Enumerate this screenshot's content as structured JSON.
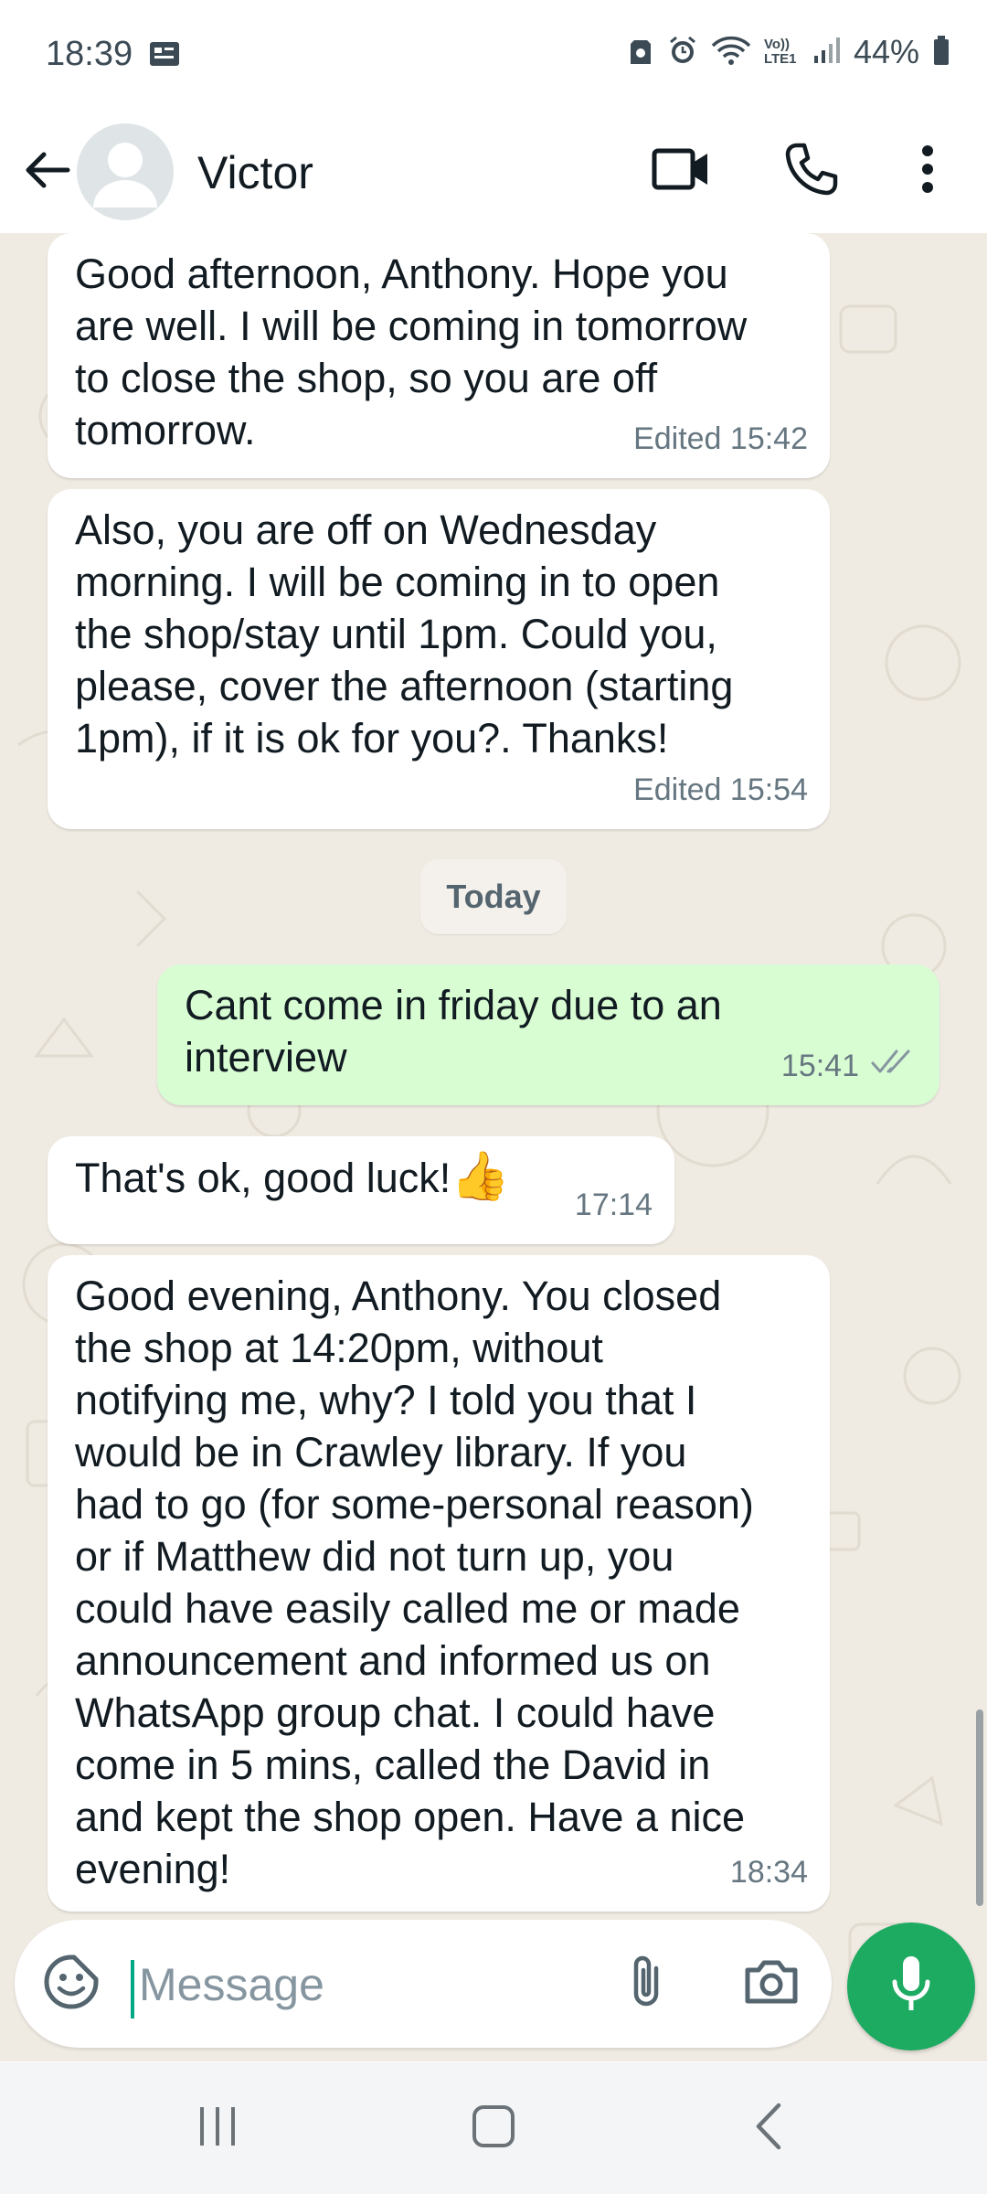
{
  "status_bar": {
    "time": "18:39",
    "network_label": "Vo)) LTE1",
    "battery": "44%"
  },
  "header": {
    "contact_name": "Victor",
    "icons": [
      "back-arrow-icon",
      "avatar-placeholder-icon",
      "video-call-icon",
      "voice-call-icon",
      "more-options-icon"
    ]
  },
  "chat": {
    "date_divider": "Today",
    "messages": [
      {
        "direction": "incoming",
        "text": "Good afternoon, Anthony. Hope you\nare well. I will be coming in tomorrow\nto close the shop, so you are off\ntomorrow.",
        "meta": "Edited 15:42"
      },
      {
        "direction": "incoming",
        "text": "Also, you are off on Wednesday\nmorning. I will be coming in to open\nthe shop/stay until 1pm. Could you,\nplease, cover the afternoon (starting\n1pm), if it is ok for you?. Thanks!",
        "meta": "Edited 15:54"
      },
      {
        "direction": "outgoing",
        "text": "Cant come in friday due to an\ninterview",
        "meta": "15:41",
        "status": "read"
      },
      {
        "direction": "incoming",
        "text": "That's ok, good luck!",
        "emoji": "👍",
        "meta": "17:14"
      },
      {
        "direction": "incoming",
        "text": "Good evening, Anthony. You closed\nthe shop at 14:20pm, without\nnotifying me, why? I told you that I\nwould be in Crawley library. If you\nhad to go (for some-personal reason)\nor if Matthew did not turn up, you\ncould have easily called me or made\nannouncement and informed us on\nWhatsApp group chat. I could have\ncome in 5 mins, called the David in\nand kept the shop open. Have a nice\nevening!",
        "meta": "18:34"
      }
    ]
  },
  "composer": {
    "placeholder": "Message",
    "value": ""
  },
  "colors": {
    "chat_background": "#efeae2",
    "outgoing_bubble": "#d9fdd3",
    "incoming_bubble": "#ffffff",
    "accent_green": "#1daa61",
    "read_tick": "#8696a0"
  }
}
